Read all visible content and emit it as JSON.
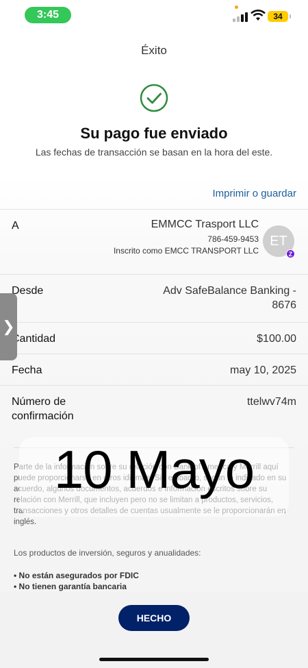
{
  "status_bar": {
    "time": "3:45",
    "battery": "34"
  },
  "header": {
    "title": "Éxito"
  },
  "confirmation": {
    "headline": "Su pago fue enviado",
    "subline": "Las fechas de transacción se basan en la hora del este.",
    "print_link": "Imprimir o guardar"
  },
  "details": {
    "to": {
      "label": "A",
      "name": "EMMCC Trasport LLC",
      "phone": "786-459-9453",
      "note": "Inscrito como EMCC TRANSPORT LLC",
      "avatar_initials": "ET",
      "badge": "Z"
    },
    "from": {
      "label": "Desde",
      "value": "Adv SafeBalance Banking - 8676"
    },
    "amount": {
      "label": "Cantidad",
      "value": "$100.00"
    },
    "date": {
      "label": "Fecha",
      "value": "may 10, 2025"
    },
    "confirmation_number": {
      "label": "Número de confirmación",
      "value": "ttelwv74m"
    }
  },
  "disclaimer": {
    "paragraph": "Parte de la información sobre su relación con Bank of America y Merrill aquí puede proporcionarse en otros idiomas. Sin embargo, según lo indicado en su acuerdo, algunos documentos, acuerdos e información escritos sobre su relación con Merrill, que incluyen pero no se limitan a productos, servicios, transacciones y otros detalles de cuentas usualmente se le proporcionarán en inglés.",
    "investments_heading": "Los productos de inversión, seguros y anualidades:",
    "bullets": [
      "• No están asegurados por FDIC",
      "• No tienen garantía bancaria"
    ]
  },
  "overlay": {
    "text": "10 Mayo"
  },
  "side_handle": {
    "glyph": "❯"
  },
  "footer": {
    "done_label": "HECHO"
  },
  "colors": {
    "accent": "#012169",
    "link": "#1d5f99",
    "success": "#2e8b3e",
    "status_pill": "#34c759"
  }
}
